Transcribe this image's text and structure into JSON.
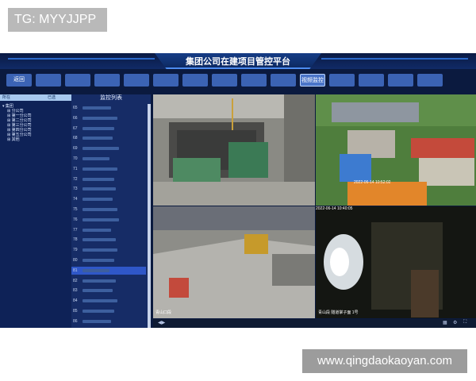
{
  "watermarks": {
    "top": "TG: MYYJJPP",
    "bottom": "www.qingdaokaoyan.com"
  },
  "app": {
    "title": "集团公司在建项目管控平台",
    "nav": [
      {
        "label": "",
        "active": false
      },
      {
        "label": "",
        "active": false
      },
      {
        "label": "",
        "active": false
      },
      {
        "label": "",
        "active": false
      },
      {
        "label": "",
        "active": false
      },
      {
        "label": "",
        "active": false
      },
      {
        "label": "",
        "active": false
      },
      {
        "label": "",
        "active": false
      },
      {
        "label": "",
        "active": false
      },
      {
        "label": "",
        "active": false
      },
      {
        "label": "视频监控",
        "active": true
      },
      {
        "label": "",
        "active": false
      },
      {
        "label": "",
        "active": false
      },
      {
        "label": "",
        "active": false
      },
      {
        "label": "",
        "active": false
      }
    ],
    "first_tab": "返回",
    "tree": {
      "head_left": "所在",
      "head_right": "已选",
      "items": [
        "集团",
        "分公司",
        "第一分公司",
        "第二分公司",
        "第三分公司",
        "第四分公司",
        "第五分公司",
        "其他"
      ]
    },
    "list": {
      "title": "监控列表",
      "rows": [
        "65",
        "66",
        "67",
        "68",
        "69",
        "70",
        "71",
        "72",
        "73",
        "74",
        "75",
        "76",
        "77",
        "78",
        "79",
        "80",
        "81",
        "82",
        "83",
        "84",
        "85",
        "86"
      ],
      "selected": "81"
    },
    "videos": {
      "v2_time": "2022-06-14 10:52:02",
      "v3_time": "2022-06-14 10:40:05",
      "v3_caption": "青山口段",
      "v4_caption": "青山段 隧道掌子面 1号"
    }
  }
}
